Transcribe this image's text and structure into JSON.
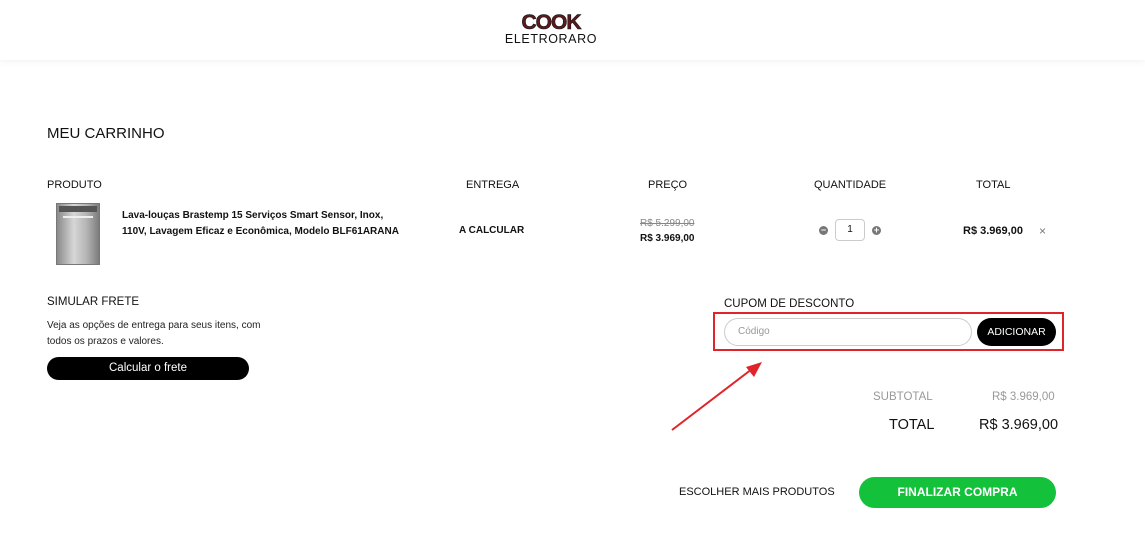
{
  "brand": {
    "logo_top": "COOK",
    "logo_bottom": "ELETRORARO"
  },
  "cart": {
    "title": "MEU CARRINHO",
    "columns": [
      "PRODUTO",
      "ENTREGA",
      "PREÇO",
      "QUANTIDADE",
      "TOTAL"
    ],
    "items": [
      {
        "name": "Lava-louças Brastemp 15 Serviços Smart Sensor, Inox, 110V, Lavagem Eficaz e Econômica, Modelo BLF61ARANA",
        "delivery": "A CALCULAR",
        "old_price": "R$ 5.299,00",
        "price": "R$ 3.969,00",
        "quantity": "1",
        "total": "R$ 3.969,00",
        "remove_icon": "×"
      }
    ]
  },
  "shipping": {
    "title": "SIMULAR FRETE",
    "text": "Veja as opções de entrega para seus itens, com todos os prazos e valores.",
    "button": "Calcular o frete"
  },
  "coupon": {
    "title": "CUPOM DE DESCONTO",
    "placeholder": "Código",
    "button": "ADICIONAR",
    "highlight_color": "#e0242b"
  },
  "summary": {
    "subtotal_label": "SUBTOTAL",
    "subtotal_value": "R$ 3.969,00",
    "total_label": "TOTAL",
    "total_value": "R$ 3.969,00"
  },
  "actions": {
    "more_products": "ESCOLHER MAIS PRODUTOS",
    "checkout": "FINALIZAR COMPRA",
    "checkout_color": "#13c13b"
  }
}
